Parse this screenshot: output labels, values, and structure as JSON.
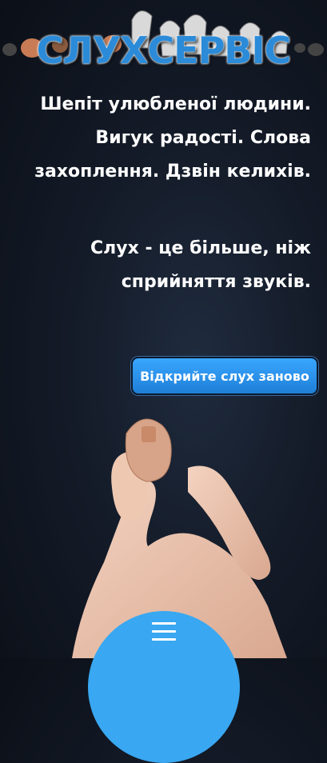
{
  "header": {
    "logo_text": "СЛУХСЕРВІС"
  },
  "intro": {
    "line1": "Шепіт улюбленої людини.",
    "line2": "Вигук радості. Слова",
    "line3": "захоплення. Дзвін келихів.",
    "line4": "Слух - це більше, ніж",
    "line5": "сприйняття звуків."
  },
  "cta": {
    "label": "Відкрийте слух заново"
  },
  "nav": {
    "menu_icon": "hamburger-icon"
  },
  "colors": {
    "accent": "#39a7f1",
    "background": "#141b28"
  }
}
